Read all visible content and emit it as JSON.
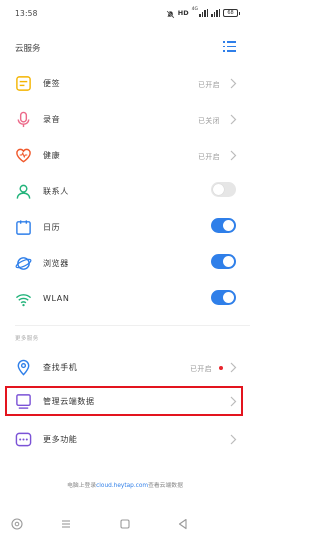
{
  "status_bar": {
    "time": "13:58",
    "network_type": "HD",
    "network_small": "4G",
    "battery": "68"
  },
  "header": {
    "title": "云服务",
    "menu_icon": "list-icon"
  },
  "accent_color": "#2f7fe9",
  "highlight_color": "#e3141e",
  "items": [
    {
      "label": "便签",
      "status": "已开启",
      "icon": "notes-icon",
      "icon_color": "#f4b400",
      "control": "chevron"
    },
    {
      "label": "录音",
      "status": "已关闭",
      "icon": "microphone-icon",
      "icon_color": "#ec6a8a",
      "control": "chevron"
    },
    {
      "label": "健康",
      "status": "已开启",
      "icon": "heart-icon",
      "icon_color": "#f0582b",
      "control": "chevron"
    },
    {
      "label": "联系人",
      "icon": "contacts-icon",
      "icon_color": "#21b37a",
      "control": "toggle",
      "toggle_on": false
    },
    {
      "label": "日历",
      "icon": "calendar-icon",
      "icon_color": "#2f7fe9",
      "control": "toggle",
      "toggle_on": true
    },
    {
      "label": "浏览器",
      "icon": "browser-icon",
      "icon_color": "#2f7fe9",
      "control": "toggle",
      "toggle_on": true
    },
    {
      "label": "WLAN",
      "icon": "wifi-icon",
      "icon_color": "#21b37a",
      "control": "toggle",
      "toggle_on": true
    }
  ],
  "section": {
    "label": "更多服务"
  },
  "more_items": [
    {
      "label": "查找手机",
      "status": "已开启",
      "icon": "find-phone-icon",
      "icon_color": "#2f7fe9",
      "control": "chevron",
      "red_dot": true
    },
    {
      "label": "管理云端数据",
      "icon": "manage-data-icon",
      "icon_color": "#7b52d6",
      "control": "chevron",
      "highlighted": true
    },
    {
      "label": "更多功能",
      "icon": "more-icon",
      "icon_color": "#7b52d6",
      "control": "chevron"
    }
  ],
  "footer": {
    "prefix": "电脑上登录",
    "link": "cloud.heytap.com",
    "suffix": "查看云端数据"
  },
  "nav_bar": {
    "items": [
      "assistant-icon",
      "menu-icon",
      "home-icon",
      "back-icon"
    ]
  }
}
